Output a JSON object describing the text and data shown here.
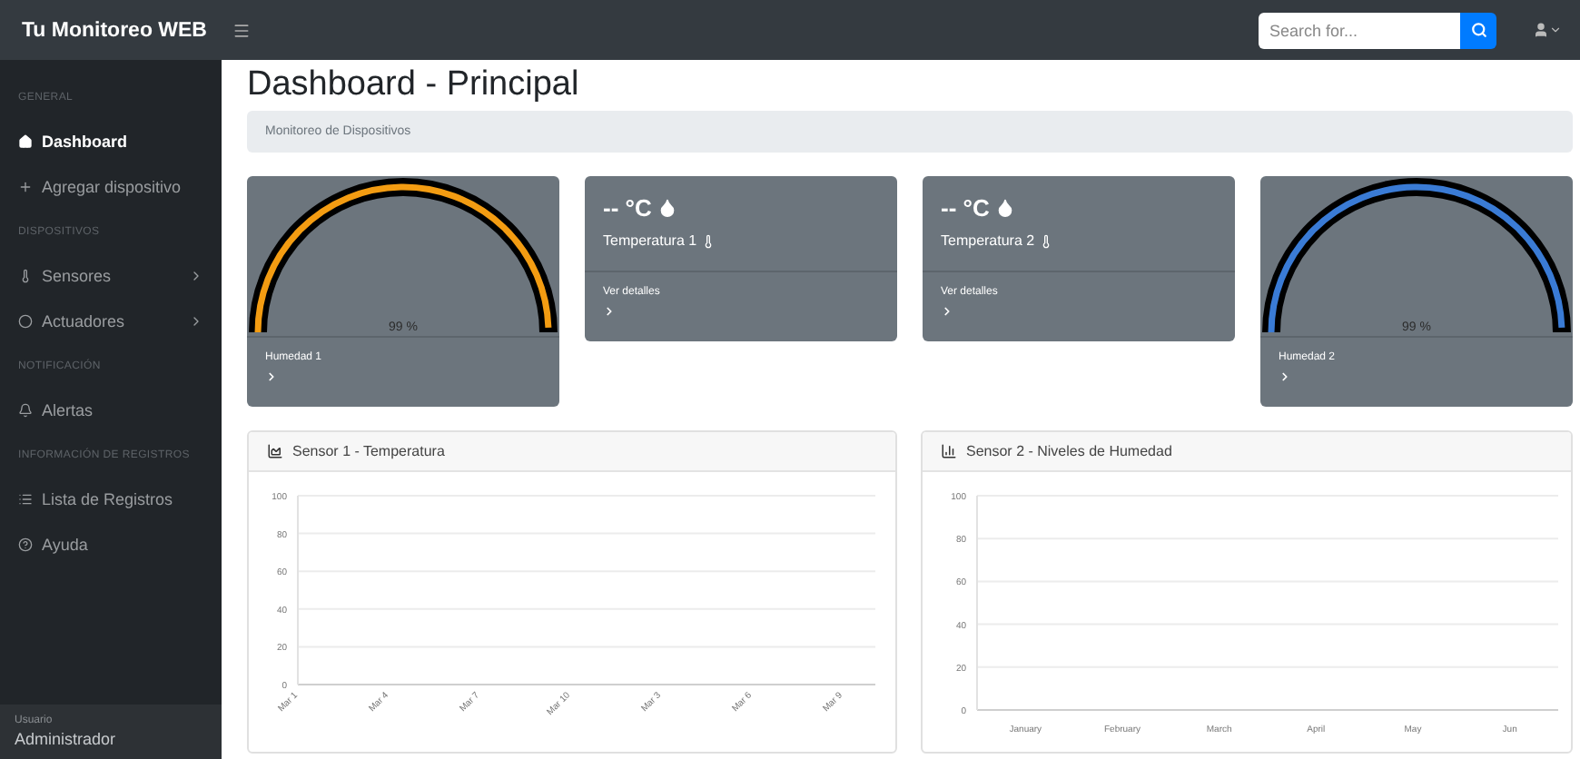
{
  "topbar": {
    "brand": "Tu Monitoreo WEB",
    "search": {
      "placeholder": "Search for..."
    }
  },
  "sidebar": {
    "sections": [
      {
        "heading": "GENERAL",
        "items": [
          {
            "label": "Dashboard",
            "selected": true,
            "kind": "link"
          },
          {
            "label": "Agregar dispositivo",
            "selected": false,
            "kind": "link"
          }
        ]
      },
      {
        "heading": "DISPOSITIVOS",
        "items": [
          {
            "label": "Sensores",
            "selected": false,
            "kind": "submenu"
          },
          {
            "label": "Actuadores",
            "selected": false,
            "kind": "submenu"
          }
        ]
      },
      {
        "heading": "NOTIFICACIÓN",
        "items": [
          {
            "label": "Alertas",
            "selected": false,
            "kind": "link"
          }
        ]
      },
      {
        "heading": "INFORMACIÓN DE REGISTROS",
        "items": [
          {
            "label": "Lista de Registros",
            "selected": false,
            "kind": "link"
          },
          {
            "label": "Ayuda",
            "selected": false,
            "kind": "link"
          }
        ]
      }
    ],
    "user": {
      "label": "Usuario",
      "name": "Administrador"
    }
  },
  "page": {
    "title": "Dashboard - Principal",
    "breadcrumb": "Monitoreo de Dispositivos"
  },
  "cards": [
    {
      "kind": "gauge",
      "label": "Humedad 1",
      "reading": "99 %",
      "level": 0.99,
      "color": "#f39c12"
    },
    {
      "kind": "reading",
      "value": "-- °C",
      "label": "Temperatura 1",
      "link": "Ver detalles"
    },
    {
      "kind": "reading",
      "value": "-- °C",
      "label": "Temperatura 2",
      "link": "Ver detalles"
    },
    {
      "kind": "gauge",
      "label": "Humedad 2",
      "reading": "99 %",
      "level": 0.99,
      "color": "#3a7bd5"
    }
  ],
  "charts": [
    {
      "title": "Sensor 1 - Temperatura",
      "chart_data": {
        "type": "line",
        "categories": [
          "Mar 1",
          "Mar 4",
          "Mar 7",
          "Mar 10",
          "Mar 3",
          "Mar 6",
          "Mar 9"
        ],
        "ylim": [
          0,
          100
        ],
        "yticks": [
          0,
          20,
          40,
          60,
          80,
          100
        ],
        "grid": true
      }
    },
    {
      "title": "Sensor 2 - Niveles de Humedad",
      "chart_data": {
        "type": "bar",
        "categories": [
          "January",
          "February",
          "March",
          "April",
          "May",
          "Jun"
        ],
        "ylim": [
          0,
          100
        ],
        "yticks": [
          0,
          20,
          40,
          60,
          80,
          100
        ],
        "grid": true
      }
    }
  ]
}
